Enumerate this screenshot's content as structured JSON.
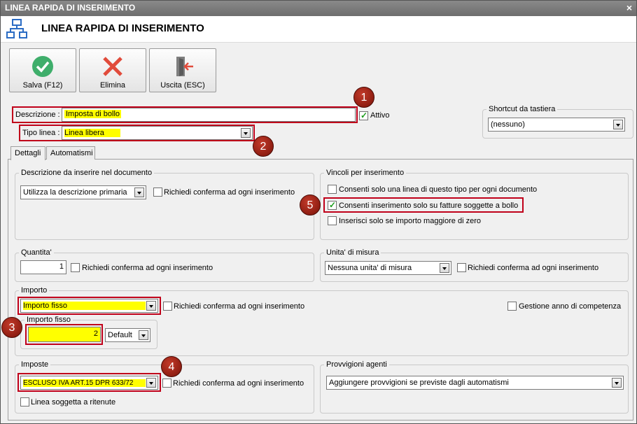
{
  "window": {
    "title": "LINEA RAPIDA DI INSERIMENTO",
    "close_glyph": "×"
  },
  "header": {
    "title": "LINEA RAPIDA DI INSERIMENTO",
    "icon": "network-tree-icon"
  },
  "toolbar": {
    "save_label": "Salva (F12)",
    "delete_label": "Elimina",
    "exit_label": "Uscita (ESC)"
  },
  "form": {
    "descrizione_label": "Descrizione :",
    "descrizione_value": "Imposta di bollo",
    "attivo_label": "Attivo",
    "attivo_checked": true,
    "tipo_linea_label": "Tipo linea :",
    "tipo_linea_value": "Linea libera",
    "shortcut_group": "Shortcut da tastiera",
    "shortcut_value": "(nessuno)"
  },
  "tabs": [
    {
      "label": "Dettagli",
      "active": true
    },
    {
      "label": "Automatismi",
      "active": false
    }
  ],
  "descrizione_doc": {
    "group": "Descrizione da inserire nel documento",
    "select_value": "Utilizza la descrizione primaria",
    "confirm_label": "Richiedi conferma ad ogni inserimento"
  },
  "vincoli": {
    "group": "Vincoli per inserimento",
    "opt1": "Consenti solo una linea di questo tipo per ogni documento",
    "opt2": "Consenti inserimento solo su fatture soggette a bollo",
    "opt3": "Inserisci solo se importo maggiore di zero",
    "opt2_checked": true
  },
  "quantita": {
    "group": "Quantita'",
    "value": "1",
    "confirm_label": "Richiedi conferma ad ogni inserimento"
  },
  "unita": {
    "group": "Unita' di misura",
    "select_value": "Nessuna unita' di misura",
    "confirm_label": "Richiedi conferma ad ogni inserimento"
  },
  "importo": {
    "group": "Importo",
    "select_value": "Importo fisso",
    "confirm_label": "Richiedi conferma ad ogni inserimento",
    "gestione_label": "Gestione anno di competenza",
    "fisso_group": "Importo fisso",
    "fisso_value": "2",
    "fisso_mode": "Default"
  },
  "imposte": {
    "group": "Imposte",
    "select_value": "ESCLUSO IVA ART.15 DPR 633/72",
    "confirm_label": "Richiedi conferma ad ogni inserimento",
    "ritenute_label": "Linea soggetta a ritenute"
  },
  "provvigioni": {
    "group": "Provvigioni agenti",
    "select_value": "Aggiungere provvigioni se previste dagli automatismi"
  },
  "badges": [
    "1",
    "2",
    "3",
    "4",
    "5"
  ],
  "colors": {
    "highlight": "#ffff00",
    "annotation_border": "#c0001a",
    "badge": "#8b1a0e"
  }
}
